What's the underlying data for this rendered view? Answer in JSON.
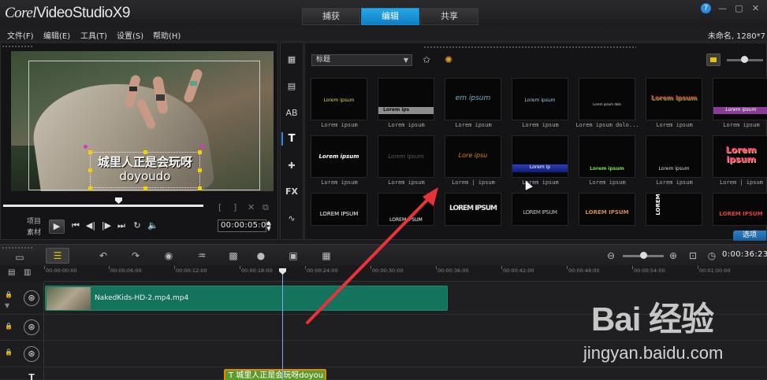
{
  "app": {
    "brand_prefix": "Corel",
    "brand_name": "VideoStudioX9"
  },
  "tabs": [
    {
      "label": "捕获",
      "active": false
    },
    {
      "label": "编辑",
      "active": true
    },
    {
      "label": "共享",
      "active": false
    }
  ],
  "menu": [
    "文件(F)",
    "编辑(E)",
    "工具(T)",
    "设置(S)",
    "帮助(H)"
  ],
  "project": {
    "name": "未命名, 1280*7"
  },
  "player": {
    "caption_line1": "城里人正是会玩呀",
    "caption_line2": "doyoudo",
    "mode_project": "项目",
    "mode_clip": "素材",
    "timecode": "00:00:05:09"
  },
  "library": {
    "category": "标题",
    "options_label": "选项",
    "rows": [
      [
        {
          "sample": "Lorem ipsum",
          "label": "Lorem ipsum"
        },
        {
          "sample": "Lorem ips",
          "label": "Lorem ipsum"
        },
        {
          "sample": "em ipsum",
          "label": "Lorem ipsum"
        },
        {
          "sample": "Lorem ipsum",
          "label": "Lorem ipsum"
        },
        {
          "sample": "Lorem ipsum dolo",
          "label": "Lorem ipsum dolo..."
        },
        {
          "sample": "Lorem ipsum",
          "label": "Lorem ipsum"
        },
        {
          "sample": "Lorem ipsum",
          "label": "Lorem ipsum"
        }
      ],
      [
        {
          "sample": "Lorem ipsum",
          "label": "Lorem ipsum"
        },
        {
          "sample": "Lorem ipsum",
          "label": "Lorem ipsum"
        },
        {
          "sample": "Lore ipsu",
          "label": "Lorem | ipsum"
        },
        {
          "sample": "Lorem ip",
          "label": "Lorem ipsum"
        },
        {
          "sample": "Lorem ipsum",
          "label": "Lorem ipsum"
        },
        {
          "sample": "Lorem ipsum",
          "label": "Lorem ipsum"
        },
        {
          "sample": "Lorem ipsum",
          "label": "Lorem | ipsum"
        }
      ],
      [
        {
          "sample": "LOREM IPSUM",
          "label": ""
        },
        {
          "sample": "LOREM IPSUM",
          "label": ""
        },
        {
          "sample": "LOREM IPSUM",
          "label": ""
        },
        {
          "sample": "LOREM IPSUM",
          "label": ""
        },
        {
          "sample": "LOREM IPSUM",
          "label": ""
        },
        {
          "sample": "LOREM",
          "label": ""
        },
        {
          "sample": "LOREM IPSUM",
          "label": ""
        }
      ]
    ]
  },
  "timeline": {
    "timecode": "0:00:36:23",
    "ruler": [
      "00:00:00:00",
      "00:00:06:00",
      "00:00:12:00",
      "00:00:18:00",
      "00:00:24:00",
      "00:00:30:00",
      "00:00:36:00",
      "00:00:42:00",
      "00:00:48:00",
      "00:00:54:00",
      "00:01:00:00"
    ],
    "video_clip": "NakedKids-HD-2.mp4.mp4",
    "title_clip": "T 城里人正是会玩呀doyou"
  },
  "watermark": {
    "logo": "Bai 经验",
    "url": "jingyan.baidu.com"
  }
}
